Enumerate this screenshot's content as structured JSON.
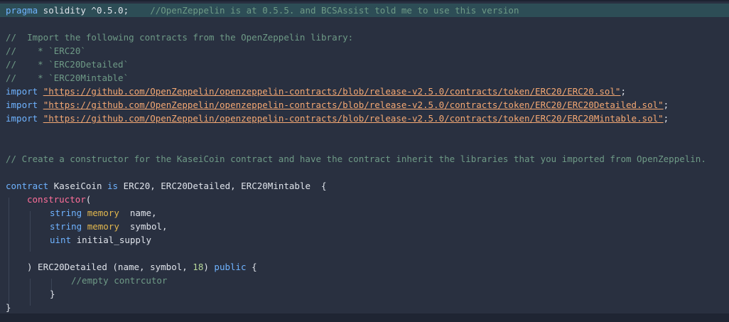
{
  "editor": {
    "colors": {
      "background": "#293040",
      "highlight": "#2d4d56",
      "keyword": "#6fb3ff",
      "storage": "#e3b84e",
      "function": "#ff6f9a",
      "comment": "#6e9a86",
      "string": "#f4a873",
      "number": "#b7d89a",
      "text": "#dfe3ea"
    },
    "l1": {
      "kw": "pragma",
      "rest": " solidity ^0.5.0;",
      "comment": "    //OpenZeppelin is at 0.5.5. and BCSAssist told me to use this version"
    },
    "l3": "//  Import the following contracts from the OpenZeppelin library:",
    "l4": "//    * `ERC20`",
    "l5": "//    * `ERC20Detailed`",
    "l6": "//    * `ERC20Mintable`",
    "imports": [
      {
        "kw": "import",
        "url": "\"https://github.com/OpenZeppelin/openzeppelin-contracts/blob/release-v2.5.0/contracts/token/ERC20/ERC20.sol\"",
        "end": ";"
      },
      {
        "kw": "import",
        "url": "\"https://github.com/OpenZeppelin/openzeppelin-contracts/blob/release-v2.5.0/contracts/token/ERC20/ERC20Detailed.sol\"",
        "end": ";"
      },
      {
        "kw": "import",
        "url": "\"https://github.com/OpenZeppelin/openzeppelin-contracts/blob/release-v2.5.0/contracts/token/ERC20/ERC20Mintable.sol\"",
        "end": ";"
      }
    ],
    "l12": "// Create a constructor for the KaseiCoin contract and have the contract inherit the libraries that you imported from OpenZeppelin.",
    "l14": {
      "kw_contract": "contract",
      "name": " KaseiCoin ",
      "kw_is": "is",
      "rest": " ERC20, ERC20Detailed, ERC20Mintable  {"
    },
    "l15": {
      "fn": "constructor",
      "paren": "("
    },
    "l16": {
      "type": "string",
      "mem": "memory",
      "name": "  name,"
    },
    "l17": {
      "type": "string",
      "mem": "memory",
      "name": "  symbol,"
    },
    "l18": {
      "type": "uint",
      "name": " initial_supply"
    },
    "l20": {
      "pre": ") ERC20Detailed (name, symbol, ",
      "num": "18",
      "post": ") ",
      "kw": "public",
      "brace": " {"
    },
    "l21": "//empty contrcutor",
    "l22": "}",
    "l23": "}"
  }
}
